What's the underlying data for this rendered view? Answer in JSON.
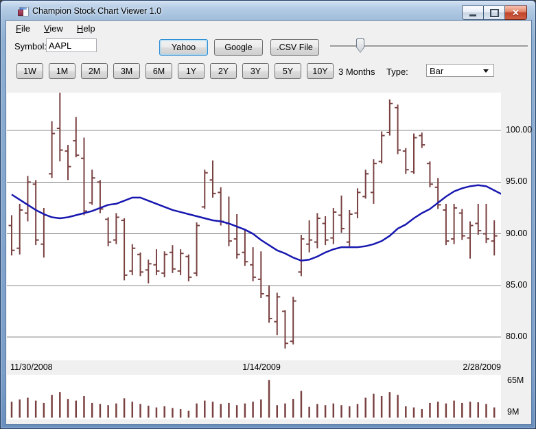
{
  "window": {
    "title": "Champion Stock Chart Viewer 1.0"
  },
  "menu": {
    "items": [
      {
        "label": "File"
      },
      {
        "label": "View"
      },
      {
        "label": "Help"
      }
    ]
  },
  "toolbar": {
    "symbol_label": "Symbol:",
    "symbol_value": "AAPL",
    "fetch_buttons": [
      {
        "label": "Yahoo"
      },
      {
        "label": "Google"
      },
      {
        "label": ".CSV File"
      }
    ]
  },
  "period_bar": {
    "buttons": [
      "1W",
      "1M",
      "2M",
      "3M",
      "6M",
      "1Y",
      "2Y",
      "3Y",
      "5Y",
      "10Y"
    ],
    "current_period": "3 Months",
    "type_label": "Type:",
    "type_value": "Bar"
  },
  "chart_data": {
    "type": "bar",
    "symbol": "AAPL",
    "period": "3 Months",
    "x_labels": [
      "11/30/2008",
      "1/14/2009",
      "2/28/2009"
    ],
    "price_ticks": [
      {
        "label": "100.00",
        "value": 100
      },
      {
        "label": "95.00",
        "value": 95
      },
      {
        "label": "90.00",
        "value": 90
      },
      {
        "label": "85.00",
        "value": 85
      },
      {
        "label": "80.00",
        "value": 80
      }
    ],
    "ylim": [
      77.8,
      103.7
    ],
    "grid": "horizontal-only",
    "legend": "none",
    "colors": {
      "bar": "#7a4141",
      "ma": "#1818b0",
      "grid": "#8a8a8a",
      "plot_bg": "#ffffff"
    },
    "bars_ohlc": [
      [
        90.8,
        91.8,
        87.9,
        88.4
      ],
      [
        88.6,
        92.9,
        88.0,
        92.3
      ],
      [
        92.0,
        95.6,
        91.2,
        95.0
      ],
      [
        94.8,
        95.2,
        88.9,
        89.4
      ],
      [
        89.0,
        92.5,
        87.7,
        91.8
      ],
      [
        95.8,
        100.9,
        95.4,
        99.7
      ],
      [
        100.2,
        103.7,
        97.0,
        98.1
      ],
      [
        98.0,
        98.6,
        95.2,
        96.5
      ],
      [
        99.0,
        101.3,
        97.4,
        97.6
      ],
      [
        97.3,
        99.3,
        91.8,
        92.2
      ],
      [
        93.0,
        96.2,
        92.8,
        95.4
      ],
      [
        95.0,
        95.2,
        92.0,
        92.4
      ],
      [
        91.4,
        91.6,
        88.8,
        89.2
      ],
      [
        89.4,
        92.0,
        89.0,
        91.6
      ],
      [
        91.3,
        91.5,
        85.5,
        86.0
      ],
      [
        86.4,
        89.0,
        86.0,
        88.6
      ],
      [
        88.0,
        88.2,
        85.9,
        86.3
      ],
      [
        86.5,
        87.5,
        85.2,
        87.1
      ],
      [
        87.0,
        88.5,
        86.0,
        86.4
      ],
      [
        86.2,
        88.3,
        85.8,
        88.0
      ],
      [
        88.2,
        88.9,
        86.2,
        86.6
      ],
      [
        86.4,
        88.5,
        86.0,
        88.1
      ],
      [
        87.8,
        88.0,
        85.4,
        85.8
      ],
      [
        86.2,
        91.1,
        85.9,
        90.8
      ],
      [
        92.6,
        96.2,
        92.4,
        95.9
      ],
      [
        95.2,
        97.1,
        93.5,
        93.9
      ],
      [
        94.0,
        94.5,
        90.8,
        91.2
      ],
      [
        91.0,
        93.6,
        88.8,
        89.3
      ],
      [
        89.5,
        91.9,
        87.6,
        88.0
      ],
      [
        88.2,
        90.4,
        86.9,
        87.3
      ],
      [
        87.0,
        88.7,
        85.4,
        85.8
      ],
      [
        85.6,
        88.3,
        83.8,
        84.2
      ],
      [
        84.0,
        85.0,
        81.4,
        81.8
      ],
      [
        81.5,
        84.3,
        80.2,
        83.9
      ],
      [
        82.5,
        82.6,
        78.9,
        79.4
      ],
      [
        79.6,
        83.9,
        79.3,
        83.5
      ],
      [
        86.3,
        89.9,
        85.9,
        89.5
      ],
      [
        89.0,
        91.3,
        88.2,
        89.4
      ],
      [
        89.2,
        92.0,
        88.6,
        91.5
      ],
      [
        91.0,
        91.7,
        88.9,
        89.4
      ],
      [
        89.6,
        92.5,
        89.0,
        92.1
      ],
      [
        91.8,
        93.7,
        90.1,
        90.5
      ],
      [
        89.2,
        92.3,
        88.8,
        91.9
      ],
      [
        92.0,
        94.4,
        91.5,
        94.0
      ],
      [
        93.6,
        96.2,
        93.4,
        95.8
      ],
      [
        94.0,
        97.2,
        92.9,
        96.8
      ],
      [
        97.0,
        99.9,
        96.8,
        99.5
      ],
      [
        99.8,
        103.0,
        99.5,
        102.6
      ],
      [
        102.2,
        102.5,
        97.7,
        98.1
      ],
      [
        98.0,
        98.3,
        95.8,
        96.2
      ],
      [
        96.0,
        99.7,
        95.8,
        99.3
      ],
      [
        99.5,
        99.8,
        98.3,
        98.6
      ],
      [
        96.8,
        97.0,
        94.5,
        94.8
      ],
      [
        94.5,
        95.4,
        92.4,
        92.8
      ],
      [
        92.3,
        92.9,
        88.9,
        89.3
      ],
      [
        89.5,
        92.9,
        89.0,
        92.5
      ],
      [
        92.0,
        92.4,
        89.4,
        89.8
      ],
      [
        89.6,
        91.2,
        87.6,
        90.8
      ],
      [
        91.0,
        92.9,
        89.9,
        90.3
      ],
      [
        90.0,
        92.9,
        89.1,
        89.5
      ],
      [
        89.3,
        91.3,
        87.9,
        89.8
      ]
    ],
    "moving_average": [
      93.8,
      93.3,
      92.8,
      92.3,
      91.9,
      91.6,
      91.5,
      91.6,
      91.8,
      92.0,
      92.2,
      92.5,
      92.8,
      92.9,
      93.2,
      93.5,
      93.5,
      93.2,
      92.9,
      92.6,
      92.3,
      92.1,
      91.9,
      91.7,
      91.5,
      91.3,
      91.2,
      91.0,
      90.7,
      90.4,
      90.0,
      89.4,
      88.9,
      88.4,
      88.1,
      87.7,
      87.4,
      87.5,
      87.8,
      88.2,
      88.5,
      88.7,
      88.7,
      88.7,
      88.8,
      89.0,
      89.3,
      89.8,
      90.5,
      90.9,
      91.5,
      92.0,
      92.4,
      93.0,
      93.6,
      94.1,
      94.4,
      94.6,
      94.7,
      94.6,
      94.2,
      93.8
    ],
    "volume_ticks": [
      {
        "label": "65M",
        "value": 65
      },
      {
        "label": "9M",
        "value": 9
      }
    ],
    "volume_millions": [
      28,
      32,
      35,
      30,
      26,
      40,
      45,
      33,
      30,
      38,
      26,
      24,
      22,
      25,
      34,
      28,
      24,
      21,
      18,
      20,
      17,
      15,
      12,
      25,
      30,
      28,
      24,
      26,
      22,
      25,
      28,
      32,
      66,
      22,
      25,
      33,
      47,
      19,
      24,
      22,
      25,
      22,
      20,
      24,
      35,
      42,
      38,
      45,
      40,
      20,
      18,
      15,
      26,
      28,
      25,
      30,
      26,
      28,
      27,
      24,
      18
    ]
  }
}
